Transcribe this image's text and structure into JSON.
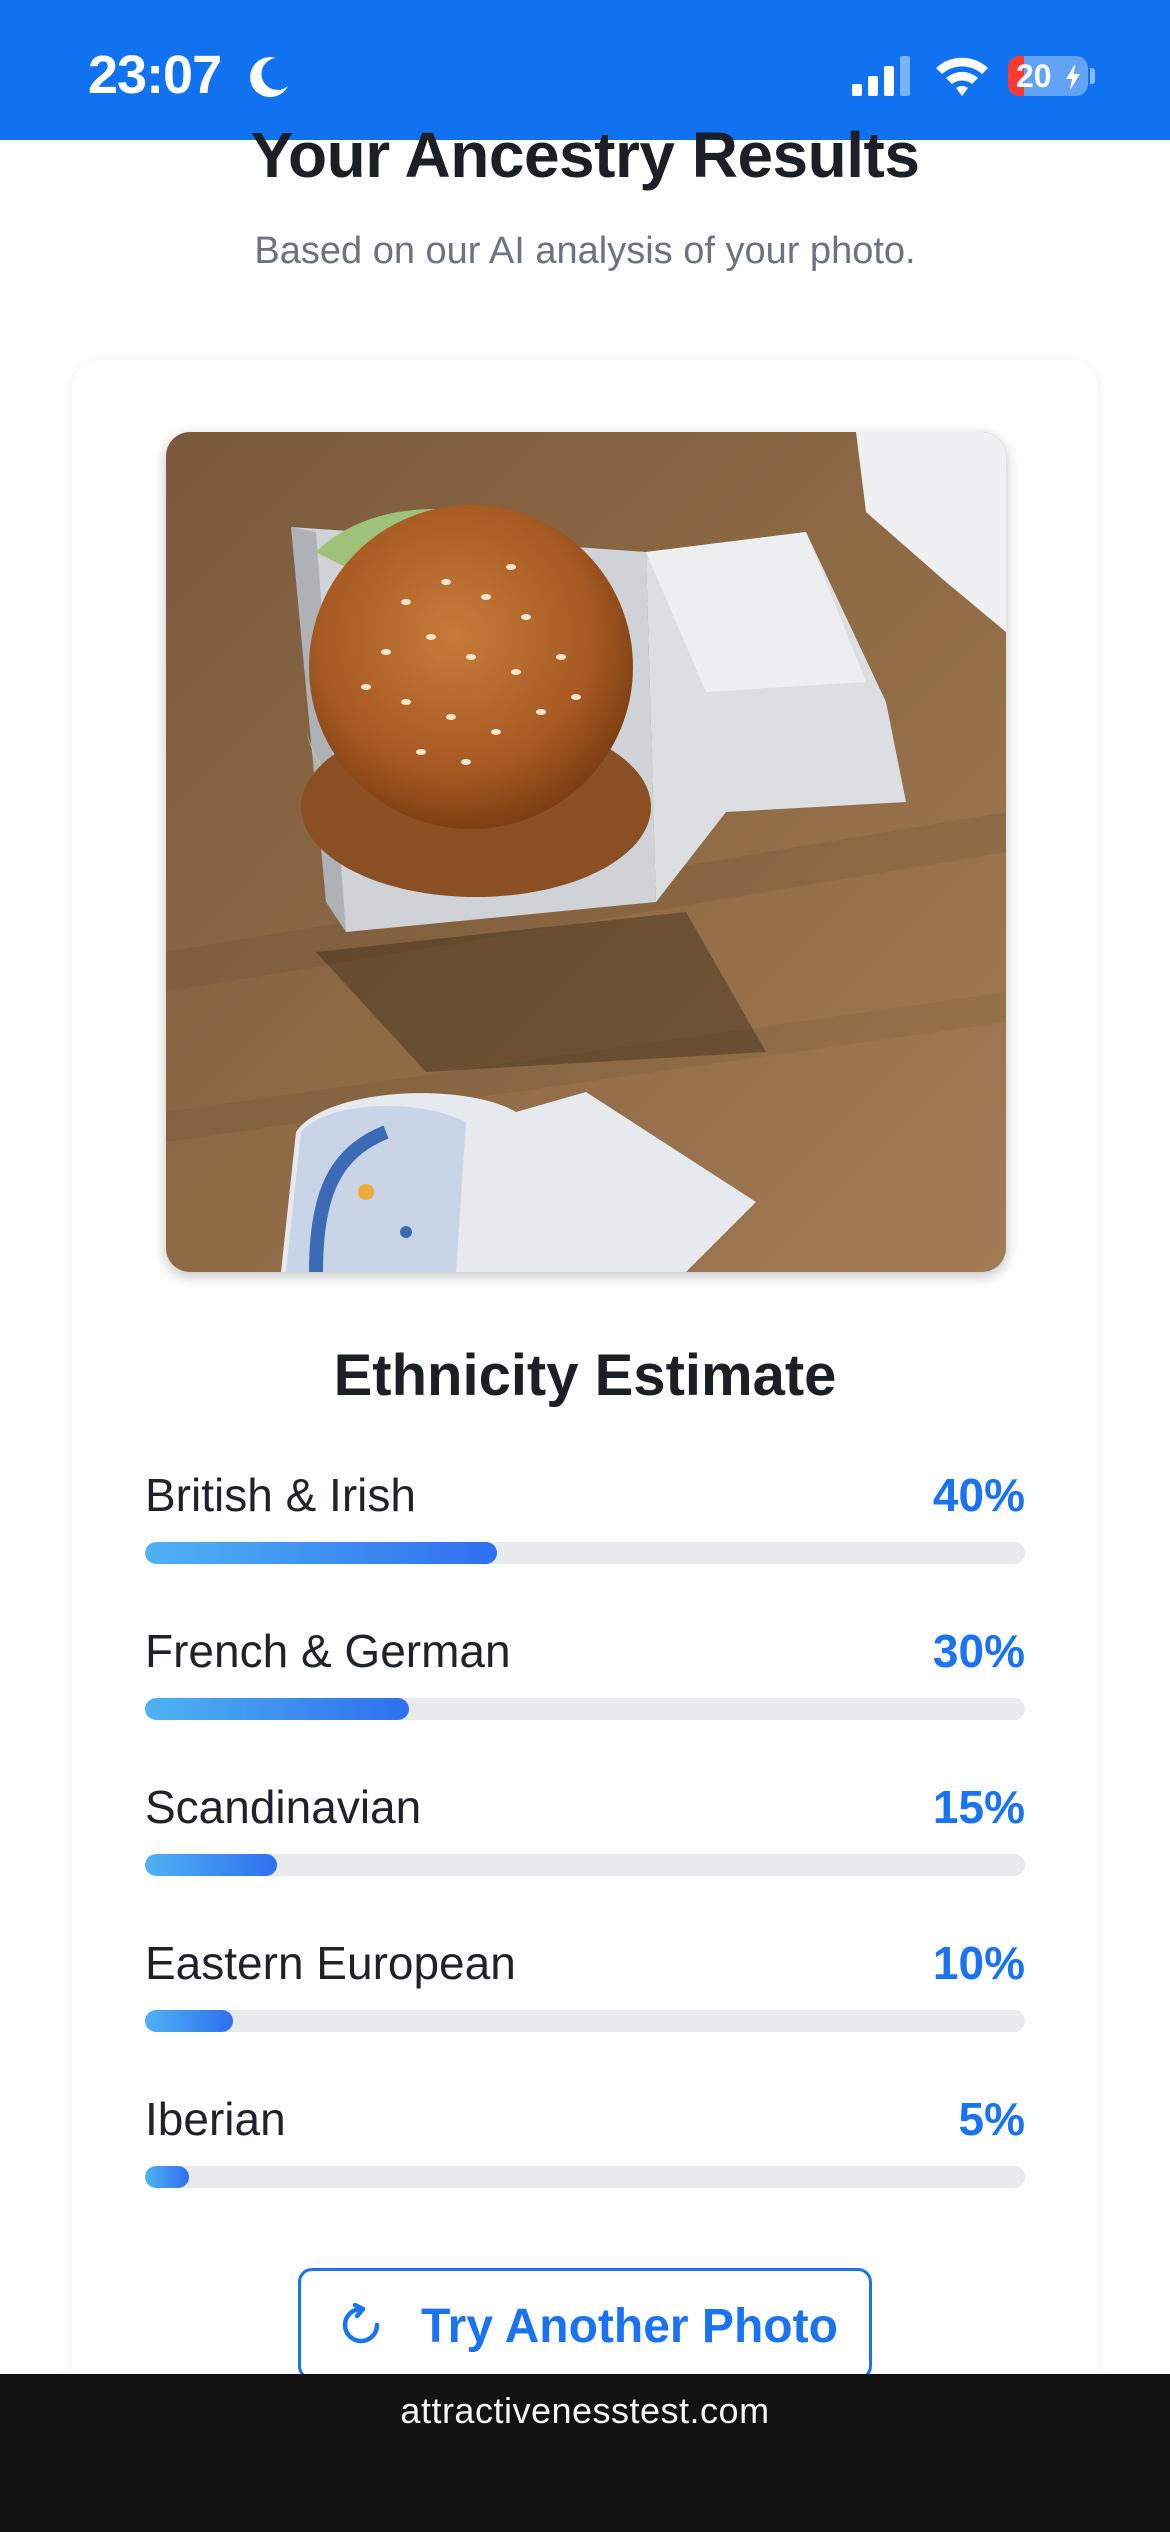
{
  "status_bar": {
    "time": "23:07",
    "battery_percent": "20",
    "battery_level": 0.2,
    "icons": [
      "moon-icon",
      "signal-icon",
      "wifi-icon",
      "battery-icon"
    ]
  },
  "header": {
    "title": "Your Ancestry Results",
    "subtitle": "Based on our AI analysis of your photo."
  },
  "results": {
    "section_title": "Ethnicity Estimate",
    "items": [
      {
        "label": "British & Irish",
        "value": "40%",
        "fraction": 0.4
      },
      {
        "label": "French & German",
        "value": "30%",
        "fraction": 0.3
      },
      {
        "label": "Scandinavian",
        "value": "15%",
        "fraction": 0.15
      },
      {
        "label": "Eastern European",
        "value": "10%",
        "fraction": 0.1
      },
      {
        "label": "Iberian",
        "value": "5%",
        "fraction": 0.05
      }
    ]
  },
  "actions": {
    "retry_label": "Try Another Photo",
    "retry_icon": "refresh-icon"
  },
  "footer": {
    "domain": "attractivenesstest.com"
  },
  "colors": {
    "status_bar": "#1072f0",
    "accent": "#1a73f0",
    "bar_gradient_start": "#4fb3f2",
    "bar_gradient_end": "#2f6ff0",
    "track": "#e8eaee"
  }
}
